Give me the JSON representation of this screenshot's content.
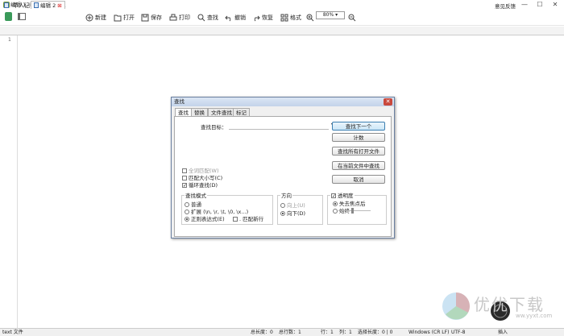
{
  "app": {
    "title": "牛人记事本 v1.0.0.1",
    "feedback": "意见反馈",
    "win_min": "—",
    "win_max": "☐",
    "win_close": "✕"
  },
  "toolbar": {
    "new": "新建",
    "open": "打开",
    "save": "保存",
    "print": "打印",
    "find": "查找",
    "undo": "撤销",
    "redo": "恢复",
    "format": "格式",
    "zoom": "80%"
  },
  "tabs": [
    {
      "label": "编辑 1"
    },
    {
      "label": "编辑 2"
    }
  ],
  "editor": {
    "line": "1"
  },
  "status": {
    "type": "text 文件",
    "total_len": "总长度：0",
    "total_lines": "总行数：1",
    "row": "行：1",
    "col": "列：1",
    "sel_len": "选择长度：0 | 0",
    "eol": "Windows (CR LF)",
    "enc": "UTF-8",
    "mode": "插入"
  },
  "dialog": {
    "title": "查找",
    "close": "✕",
    "tabs": [
      "查找",
      "替换",
      "文件查找",
      "标记"
    ],
    "target_label": "查找目标：",
    "target_value": "",
    "buttons": {
      "find_next": "查找下一个",
      "count": "计数",
      "find_all_open": "查找所有打开文件",
      "find_all_current": "在当前文件中查找",
      "cancel": "取消"
    },
    "options": {
      "whole_word": "全词匹配(W)",
      "match_case": "匹配大小写(C)",
      "wrap": "循环查找(D)"
    },
    "mode": {
      "legend": "查找模式",
      "normal": "普通",
      "extended": "扩展 (\\n, \\r, \\t, \\0, \\x...)",
      "regex": "正则表达式(E)",
      "dot_nl": ". 匹配新行"
    },
    "direction": {
      "legend": "方向",
      "up": "向上(U)",
      "down": "向下(D)"
    },
    "transparency": {
      "legend": "透明度",
      "on_focus": "失去焦点后",
      "always": "始终"
    }
  },
  "watermark": {
    "text": "优优下载",
    "sub": "ww.yyxt.com"
  }
}
